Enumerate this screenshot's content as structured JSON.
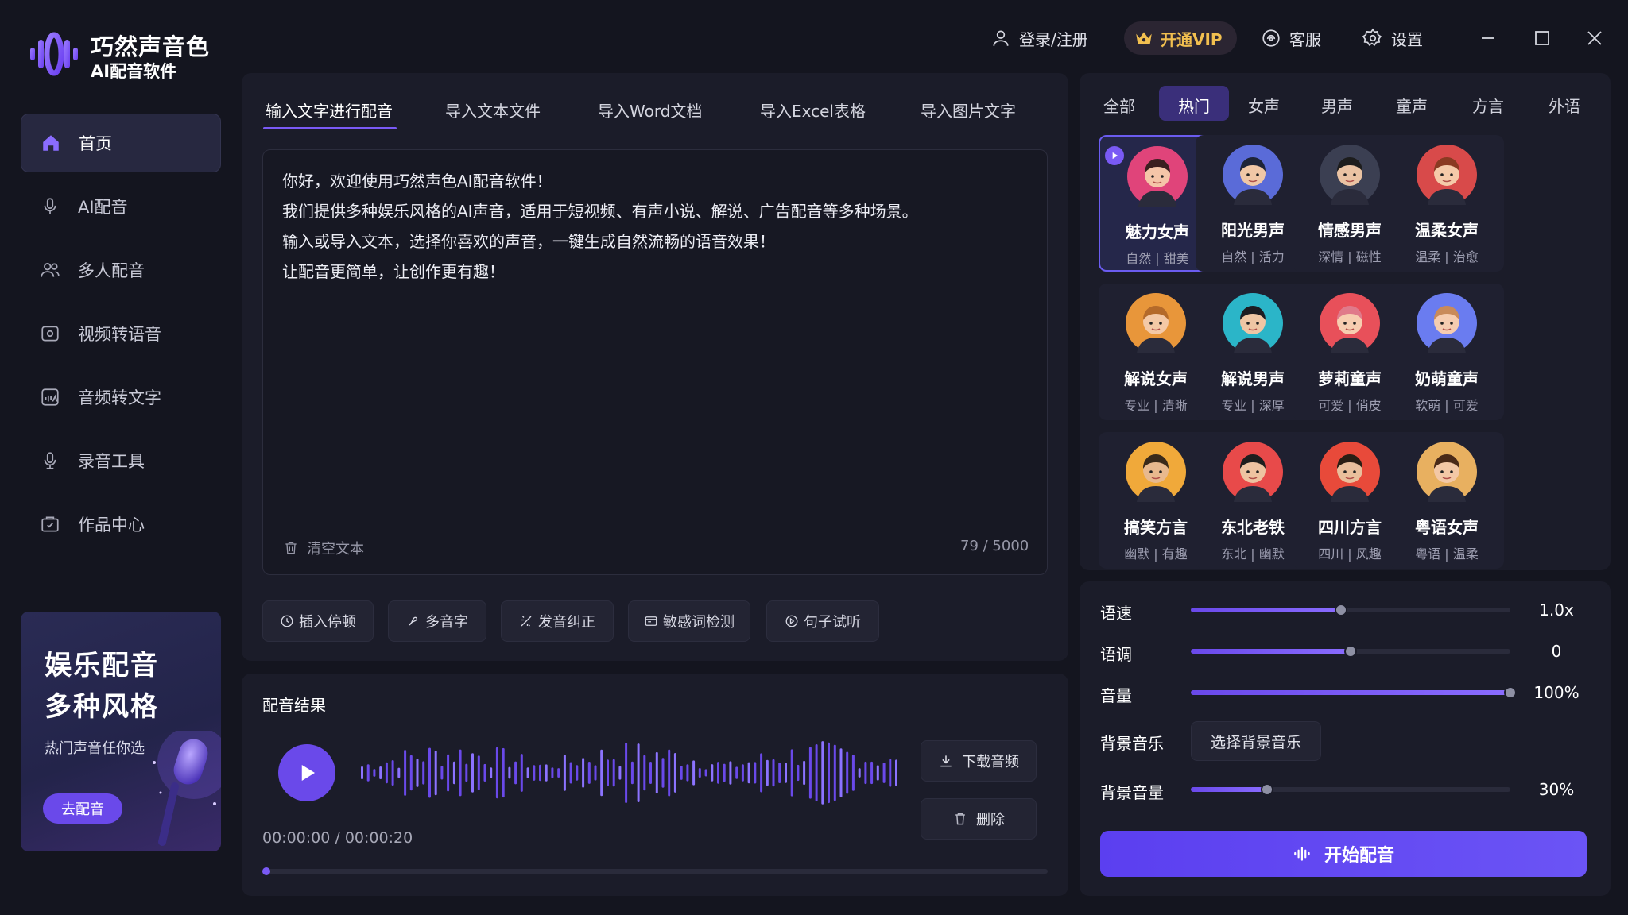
{
  "app": {
    "title": "巧然声音色",
    "subtitle": "AI配音软件"
  },
  "topbar": {
    "login": "登录/注册",
    "vip": "开通VIP",
    "service": "客服",
    "settings": "设置"
  },
  "sidebar": {
    "items": [
      {
        "label": "首页",
        "icon": "home-icon",
        "active": true
      },
      {
        "label": "AI配音",
        "icon": "microphone-icon"
      },
      {
        "label": "多人配音",
        "icon": "users-icon"
      },
      {
        "label": "视频转语音",
        "icon": "video-icon"
      },
      {
        "label": "音频转文字",
        "icon": "audio-to-text-icon"
      },
      {
        "label": "录音工具",
        "icon": "recorder-icon"
      },
      {
        "label": "作品中心",
        "icon": "works-icon"
      }
    ],
    "promo": {
      "line1": "娱乐配音",
      "line2": "多种风格",
      "sub": "热门声音任你选",
      "button": "去配音"
    }
  },
  "editor": {
    "tabs": [
      "输入文字进行配音",
      "导入文本文件",
      "导入Word文档",
      "导入Excel表格",
      "导入图片文字"
    ],
    "active_tab": 0,
    "lines": [
      "你好，欢迎使用巧然声色AI配音软件！",
      "我们提供多种娱乐风格的AI声音，适用于短视频、有声小说、解说、广告配音等多种场景。",
      "输入或导入文本，选择你喜欢的声音，一键生成自然流畅的语音效果！",
      "让配音更简单，让创作更有趣！"
    ],
    "clear": "清空文本",
    "counter": "79 / 5000",
    "tools": [
      "插入停顿",
      "多音字",
      "发音纠正",
      "敏感词检测",
      "句子试听"
    ]
  },
  "result": {
    "title": "配音结果",
    "current_time": "00:00:00",
    "separator": "/",
    "total_time": "00:00:20",
    "progress": 0,
    "download": "下载音频",
    "delete": "删除"
  },
  "voices": {
    "tabs": [
      "全部",
      "热门",
      "女声",
      "男声",
      "童声",
      "方言",
      "外语"
    ],
    "active_tab": 1,
    "list": [
      {
        "name": "魅力女声",
        "desc": "自然 | 甜美",
        "selected": true
      },
      {
        "name": "阳光男声",
        "desc": "自然 | 活力"
      },
      {
        "name": "情感男声",
        "desc": "深情 | 磁性"
      },
      {
        "name": "温柔女声",
        "desc": "温柔 | 治愈"
      },
      {
        "name": "解说女声",
        "desc": "专业 | 清晰"
      },
      {
        "name": "解说男声",
        "desc": "专业 | 深厚"
      },
      {
        "name": "萝莉童声",
        "desc": "可爱 | 俏皮"
      },
      {
        "name": "奶萌童声",
        "desc": "软萌 | 可爱"
      },
      {
        "name": "搞笑方言",
        "desc": "幽默 | 有趣"
      },
      {
        "name": "东北老铁",
        "desc": "东北 | 幽默"
      },
      {
        "name": "四川方言",
        "desc": "四川 | 风趣"
      },
      {
        "name": "粤语女声",
        "desc": "粤语 | 温柔"
      }
    ]
  },
  "params": {
    "speed": {
      "label": "语速",
      "value": "1.0x",
      "level": 0.47
    },
    "pitch": {
      "label": "语调",
      "value": "0",
      "level": 0.5
    },
    "volume": {
      "label": "音量",
      "value": "100%",
      "level": 1.0
    },
    "bgm": {
      "label": "背景音乐",
      "button": "选择背景音乐"
    },
    "bgm_volume": {
      "label": "背景音量",
      "value": "30%",
      "level": 0.24
    },
    "start": "开始配音"
  },
  "colors": {
    "accent": "#6a49ea",
    "panel": "#1b1c29",
    "background": "#14151f",
    "vip": "#f1bf4f"
  }
}
